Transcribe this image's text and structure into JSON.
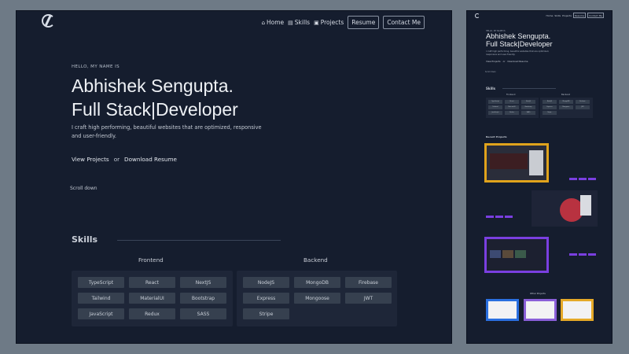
{
  "nav": {
    "home": "Home",
    "skills": "Skills",
    "projects": "Projects",
    "resume": "Resume",
    "contact": "Contact Me"
  },
  "hero": {
    "hello": "HELLO, MY NAME IS",
    "name": "Abhishek Sengupta.",
    "role": "Full Stack|Developer",
    "description": "I craft high performing, beautiful websites that are optimized, responsive and user-friendly.",
    "view_projects": "View Projects",
    "or": "or",
    "download_resume": "Download Resume",
    "scroll": "Scroll down"
  },
  "skills": {
    "title": "Skills",
    "frontend_title": "Frontend",
    "backend_title": "Backend",
    "frontend": [
      "TypeScript",
      "React",
      "NextJS",
      "Tailwind",
      "MaterialUI",
      "Bootstrap",
      "JavaScript",
      "Redux",
      "SASS"
    ],
    "backend": [
      "NodeJS",
      "MongoDB",
      "Firebase",
      "Express",
      "Mongoose",
      "JWT",
      "Stripe"
    ]
  },
  "side": {
    "recent_projects": "Recent Projects",
    "other_projects": "Other Projects"
  }
}
